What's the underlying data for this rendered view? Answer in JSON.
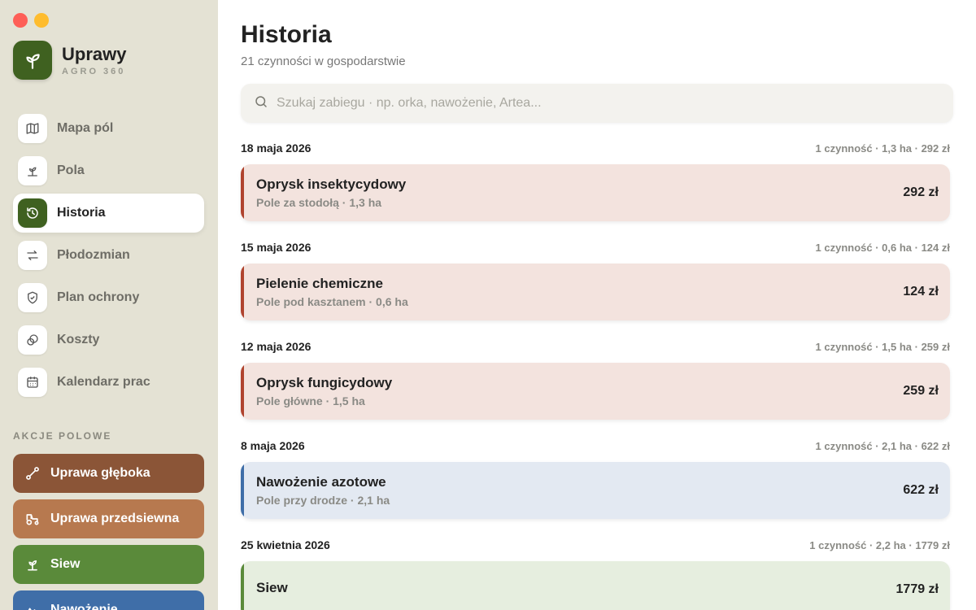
{
  "app": {
    "name": "Uprawy",
    "subtitle": "AGRO 360",
    "accent": "#3f6120"
  },
  "sidebar": {
    "nav": [
      {
        "label": "Mapa pól",
        "icon": "map-icon",
        "active": false
      },
      {
        "label": "Pola",
        "icon": "sprout-icon",
        "active": false
      },
      {
        "label": "Historia",
        "icon": "history-icon",
        "active": true
      },
      {
        "label": "Płodozmian",
        "icon": "rotate-icon",
        "active": false
      },
      {
        "label": "Plan ochrony",
        "icon": "shield-icon",
        "active": false
      },
      {
        "label": "Koszty",
        "icon": "coins-icon",
        "active": false
      },
      {
        "label": "Kalendarz prac",
        "icon": "calendar-icon",
        "active": false
      }
    ],
    "section_label": "AKCJE POLOWE",
    "actions": [
      {
        "label": "Uprawa głęboka",
        "icon": "plow-icon",
        "color": "#8b5537"
      },
      {
        "label": "Uprawa przedsiewna",
        "icon": "tractor-icon",
        "color": "#b7794f"
      },
      {
        "label": "Siew",
        "icon": "seedling-icon",
        "color": "#5a8a3a"
      },
      {
        "label": "Nawożenie",
        "icon": "fertilizer-icon",
        "color": "#3f6ea8"
      }
    ]
  },
  "main": {
    "title": "Historia",
    "subtitle": "21 czynności w gospodarstwie",
    "search_placeholder": "Szukaj zabiegu · np. orka, nawożenie, Artea...",
    "groups": [
      {
        "date": "18 maja 2026",
        "summary": "1 czynność · 1,3 ha · 292 zł",
        "entries": [
          {
            "title": "Oprysk insektycydowy",
            "field": "Pole za stodołą · 1,3 ha",
            "cost": "292 zł",
            "bg": "#f3e3de",
            "stripe": "#b0442f"
          }
        ]
      },
      {
        "date": "15 maja 2026",
        "summary": "1 czynność · 0,6 ha · 124 zł",
        "entries": [
          {
            "title": "Pielenie chemiczne",
            "field": "Pole pod kasztanem · 0,6 ha",
            "cost": "124 zł",
            "bg": "#f3e3de",
            "stripe": "#b0442f"
          }
        ]
      },
      {
        "date": "12 maja 2026",
        "summary": "1 czynność · 1,5 ha · 259 zł",
        "entries": [
          {
            "title": "Oprysk fungicydowy",
            "field": "Pole główne · 1,5 ha",
            "cost": "259 zł",
            "bg": "#f3e3de",
            "stripe": "#b0442f"
          }
        ]
      },
      {
        "date": "8 maja 2026",
        "summary": "1 czynność · 2,1 ha · 622 zł",
        "entries": [
          {
            "title": "Nawożenie azotowe",
            "field": "Pole przy drodze · 2,1 ha",
            "cost": "622 zł",
            "bg": "#e3e9f2",
            "stripe": "#3f6ea8"
          }
        ]
      },
      {
        "date": "25 kwietnia 2026",
        "summary": "1 czynność · 2,2 ha · 1779 zł",
        "entries": [
          {
            "title": "Siew",
            "field": "",
            "cost": "1779 zł",
            "bg": "#e6eedf",
            "stripe": "#5a8a3a"
          }
        ]
      }
    ]
  }
}
